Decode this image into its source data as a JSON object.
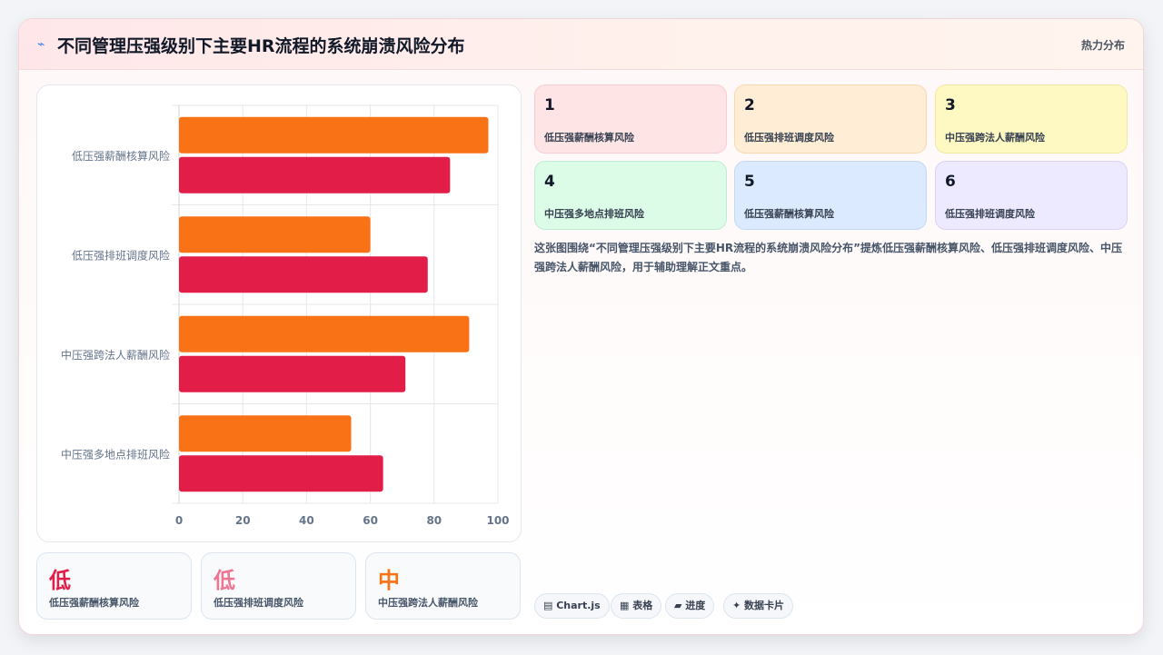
{
  "header": {
    "icon": "bolt-icon",
    "title": "不同管理压强级别下主要HR流程的系统崩溃风险分布",
    "badge": "热力分布"
  },
  "chart_data": {
    "type": "bar",
    "orientation": "horizontal",
    "categories": [
      "低压强薪酬核算风险",
      "低压强排班调度风险",
      "中压强跨法人薪酬风险",
      "中压强多地点排班风险"
    ],
    "series": [
      {
        "color": "#f97316",
        "values": [
          97,
          60,
          91,
          54
        ]
      },
      {
        "color": "#e11d48",
        "values": [
          85,
          78,
          71,
          64
        ]
      }
    ],
    "xlim": [
      0,
      100
    ],
    "xticks": [
      0,
      20,
      40,
      60,
      80,
      100
    ],
    "grid": true
  },
  "levels": [
    {
      "level": "低",
      "label": "低压强薪酬核算风险",
      "color": "#e11d48"
    },
    {
      "level": "低",
      "label": "低压强排班调度风险",
      "color": "#f07590"
    },
    {
      "level": "中",
      "label": "中压强跨法人薪酬风险",
      "color": "#f97316"
    }
  ],
  "tiles": [
    {
      "num": "1",
      "label": "低压强薪酬核算风险",
      "bg": "#ffe4e6",
      "border": "#f7cdd3"
    },
    {
      "num": "2",
      "label": "低压强排班调度风险",
      "bg": "#ffedd5",
      "border": "#f8d9b3"
    },
    {
      "num": "3",
      "label": "中压强跨法人薪酬风险",
      "bg": "#fef9c3",
      "border": "#f2e7a2"
    },
    {
      "num": "4",
      "label": "中压强多地点排班风险",
      "bg": "#dcfce7",
      "border": "#bfecd0"
    },
    {
      "num": "5",
      "label": "低压强薪酬核算风险",
      "bg": "#dbeafe",
      "border": "#c2d8f5"
    },
    {
      "num": "6",
      "label": "低压强排班调度风险",
      "bg": "#ede9fe",
      "border": "#d9d2f5"
    }
  ],
  "description": "这张图围绕“不同管理压强级别下主要HR流程的系统崩溃风险分布”提炼低压强薪酬核算风险、低压强排班调度风险、中压强跨法人薪酬风险，用于辅助理解正文重点。",
  "tech_tags": [
    {
      "icon": "table-icon",
      "label": "▤ Chart.js"
    },
    {
      "icon": "grid-icon",
      "label": "▦ 表格"
    },
    {
      "icon": "progress-icon",
      "label": "▰ 进度"
    },
    {
      "icon": "sparkle-icon",
      "label": "✦ 数据卡片"
    }
  ]
}
